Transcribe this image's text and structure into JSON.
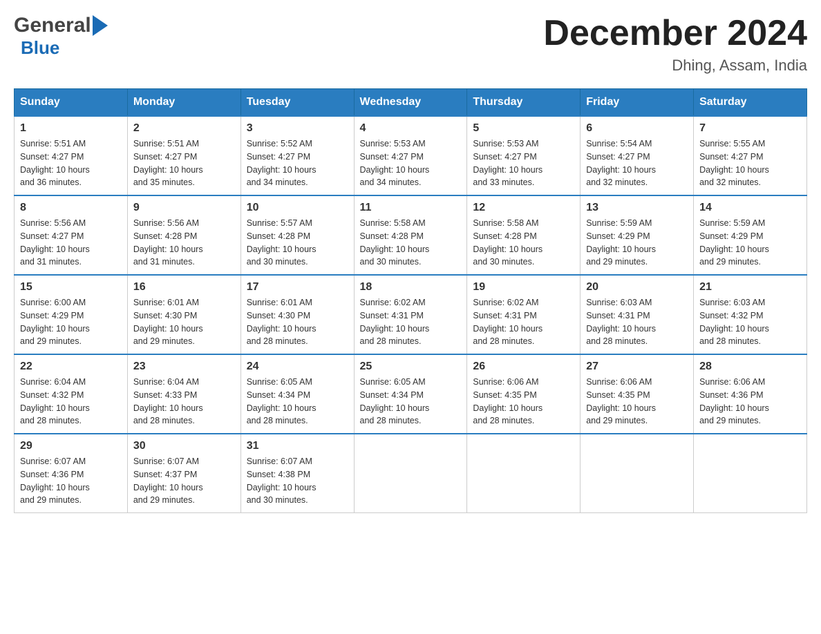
{
  "logo": {
    "general": "General",
    "blue": "Blue"
  },
  "header": {
    "title": "December 2024",
    "location": "Dhing, Assam, India"
  },
  "weekdays": [
    "Sunday",
    "Monday",
    "Tuesday",
    "Wednesday",
    "Thursday",
    "Friday",
    "Saturday"
  ],
  "weeks": [
    [
      {
        "day": "1",
        "sunrise": "5:51 AM",
        "sunset": "4:27 PM",
        "daylight": "10 hours and 36 minutes."
      },
      {
        "day": "2",
        "sunrise": "5:51 AM",
        "sunset": "4:27 PM",
        "daylight": "10 hours and 35 minutes."
      },
      {
        "day": "3",
        "sunrise": "5:52 AM",
        "sunset": "4:27 PM",
        "daylight": "10 hours and 34 minutes."
      },
      {
        "day": "4",
        "sunrise": "5:53 AM",
        "sunset": "4:27 PM",
        "daylight": "10 hours and 34 minutes."
      },
      {
        "day": "5",
        "sunrise": "5:53 AM",
        "sunset": "4:27 PM",
        "daylight": "10 hours and 33 minutes."
      },
      {
        "day": "6",
        "sunrise": "5:54 AM",
        "sunset": "4:27 PM",
        "daylight": "10 hours and 32 minutes."
      },
      {
        "day": "7",
        "sunrise": "5:55 AM",
        "sunset": "4:27 PM",
        "daylight": "10 hours and 32 minutes."
      }
    ],
    [
      {
        "day": "8",
        "sunrise": "5:56 AM",
        "sunset": "4:27 PM",
        "daylight": "10 hours and 31 minutes."
      },
      {
        "day": "9",
        "sunrise": "5:56 AM",
        "sunset": "4:28 PM",
        "daylight": "10 hours and 31 minutes."
      },
      {
        "day": "10",
        "sunrise": "5:57 AM",
        "sunset": "4:28 PM",
        "daylight": "10 hours and 30 minutes."
      },
      {
        "day": "11",
        "sunrise": "5:58 AM",
        "sunset": "4:28 PM",
        "daylight": "10 hours and 30 minutes."
      },
      {
        "day": "12",
        "sunrise": "5:58 AM",
        "sunset": "4:28 PM",
        "daylight": "10 hours and 30 minutes."
      },
      {
        "day": "13",
        "sunrise": "5:59 AM",
        "sunset": "4:29 PM",
        "daylight": "10 hours and 29 minutes."
      },
      {
        "day": "14",
        "sunrise": "5:59 AM",
        "sunset": "4:29 PM",
        "daylight": "10 hours and 29 minutes."
      }
    ],
    [
      {
        "day": "15",
        "sunrise": "6:00 AM",
        "sunset": "4:29 PM",
        "daylight": "10 hours and 29 minutes."
      },
      {
        "day": "16",
        "sunrise": "6:01 AM",
        "sunset": "4:30 PM",
        "daylight": "10 hours and 29 minutes."
      },
      {
        "day": "17",
        "sunrise": "6:01 AM",
        "sunset": "4:30 PM",
        "daylight": "10 hours and 28 minutes."
      },
      {
        "day": "18",
        "sunrise": "6:02 AM",
        "sunset": "4:31 PM",
        "daylight": "10 hours and 28 minutes."
      },
      {
        "day": "19",
        "sunrise": "6:02 AM",
        "sunset": "4:31 PM",
        "daylight": "10 hours and 28 minutes."
      },
      {
        "day": "20",
        "sunrise": "6:03 AM",
        "sunset": "4:31 PM",
        "daylight": "10 hours and 28 minutes."
      },
      {
        "day": "21",
        "sunrise": "6:03 AM",
        "sunset": "4:32 PM",
        "daylight": "10 hours and 28 minutes."
      }
    ],
    [
      {
        "day": "22",
        "sunrise": "6:04 AM",
        "sunset": "4:32 PM",
        "daylight": "10 hours and 28 minutes."
      },
      {
        "day": "23",
        "sunrise": "6:04 AM",
        "sunset": "4:33 PM",
        "daylight": "10 hours and 28 minutes."
      },
      {
        "day": "24",
        "sunrise": "6:05 AM",
        "sunset": "4:34 PM",
        "daylight": "10 hours and 28 minutes."
      },
      {
        "day": "25",
        "sunrise": "6:05 AM",
        "sunset": "4:34 PM",
        "daylight": "10 hours and 28 minutes."
      },
      {
        "day": "26",
        "sunrise": "6:06 AM",
        "sunset": "4:35 PM",
        "daylight": "10 hours and 28 minutes."
      },
      {
        "day": "27",
        "sunrise": "6:06 AM",
        "sunset": "4:35 PM",
        "daylight": "10 hours and 29 minutes."
      },
      {
        "day": "28",
        "sunrise": "6:06 AM",
        "sunset": "4:36 PM",
        "daylight": "10 hours and 29 minutes."
      }
    ],
    [
      {
        "day": "29",
        "sunrise": "6:07 AM",
        "sunset": "4:36 PM",
        "daylight": "10 hours and 29 minutes."
      },
      {
        "day": "30",
        "sunrise": "6:07 AM",
        "sunset": "4:37 PM",
        "daylight": "10 hours and 29 minutes."
      },
      {
        "day": "31",
        "sunrise": "6:07 AM",
        "sunset": "4:38 PM",
        "daylight": "10 hours and 30 minutes."
      },
      null,
      null,
      null,
      null
    ]
  ],
  "labels": {
    "sunrise": "Sunrise:",
    "sunset": "Sunset:",
    "daylight": "Daylight:"
  }
}
